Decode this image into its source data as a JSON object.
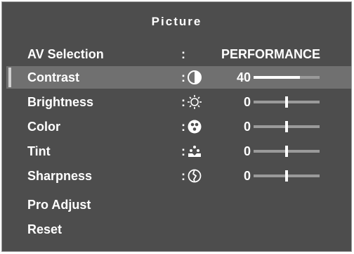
{
  "menu": {
    "title": "Picture",
    "colon": ":",
    "items": [
      {
        "label": "AV Selection",
        "value_text": "PERFORMANCE"
      },
      {
        "label": "Contrast",
        "value": "40",
        "level": 0.7,
        "icon": "contrast-icon",
        "selected": true
      },
      {
        "label": "Brightness",
        "value": "0",
        "level": 0.5,
        "icon": "sun-icon"
      },
      {
        "label": "Color",
        "value": "0",
        "level": 0.5,
        "icon": "color-palette-icon"
      },
      {
        "label": "Tint",
        "value": "0",
        "level": 0.5,
        "icon": "tint-icon"
      },
      {
        "label": "Sharpness",
        "value": "0",
        "level": 0.5,
        "icon": "sharpness-icon"
      },
      {
        "label": "Pro Adjust"
      },
      {
        "label": "Reset"
      }
    ]
  },
  "colors": {
    "background": "#4d4d4d",
    "selected_row": "#707070",
    "text": "#ffffff",
    "slider_track": "#9a9a9a",
    "slider_fill": "#ffffff"
  }
}
